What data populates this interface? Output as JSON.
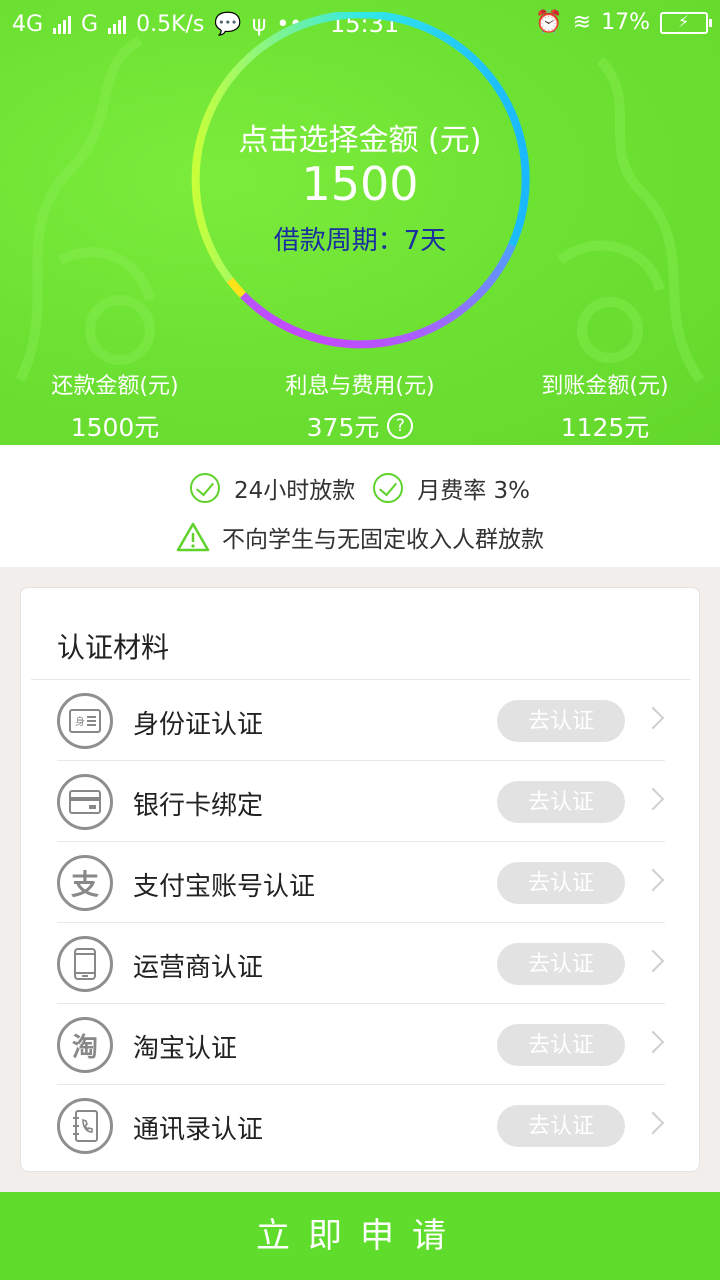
{
  "status_bar": {
    "net1": "4G",
    "net2": "G",
    "speed": "0.5K/s",
    "more": "•••",
    "time": "15:31",
    "battery": "17%"
  },
  "loan": {
    "select_label": "点击选择金额 (元)",
    "amount": "1500",
    "period": "借款周期：7天"
  },
  "stats": [
    {
      "label": "还款金额(元)",
      "value": "1500元"
    },
    {
      "label": "利息与费用(元)",
      "value": "375元"
    },
    {
      "label": "到账金额(元)",
      "value": "1125元"
    }
  ],
  "info": {
    "feature1": "24小时放款",
    "feature2": "月费率 3%",
    "warning": "不向学生与无固定收入人群放款"
  },
  "verification": {
    "title": "认证材料",
    "action_label": "去认证",
    "items": [
      {
        "label": "身份证认证",
        "icon": "id-card-icon"
      },
      {
        "label": "银行卡绑定",
        "icon": "bank-card-icon"
      },
      {
        "label": "支付宝账号认证",
        "icon": "alipay-icon"
      },
      {
        "label": "运营商认证",
        "icon": "phone-icon"
      },
      {
        "label": "淘宝认证",
        "icon": "taobao-icon"
      },
      {
        "label": "通讯录认证",
        "icon": "contacts-icon"
      }
    ]
  },
  "apply_button": "立即申请",
  "colors": {
    "brand_green": "#5fdc2c",
    "period_blue": "#1a2fa0"
  }
}
